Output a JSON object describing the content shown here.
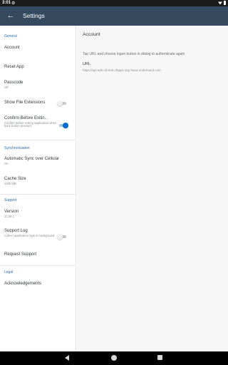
{
  "status_bar": {
    "time": "3:01",
    "system_icon": "settings-gear-icon"
  },
  "app_bar": {
    "back_icon": "arrow-back-icon",
    "title": "Settings"
  },
  "sections": {
    "general": {
      "header": "General",
      "account": "Account",
      "reset_app": "Reset App",
      "passcode": {
        "title": "Passcode",
        "value": "Off"
      },
      "show_file_extensions": {
        "title": "Show File Extensions",
        "enabled": false
      },
      "confirm_before_exit": {
        "title": "Confirm Before Exitin..",
        "subtitle": "Confirm before exiting application when back button pressed",
        "enabled": true
      }
    },
    "synchronization": {
      "header": "Synchronization",
      "auto_sync": {
        "title": "Automatic Sync over Cellular",
        "value": "On"
      },
      "cache_size": {
        "title": "Cache Size",
        "value": "1000 MB"
      }
    },
    "support": {
      "header": "Support",
      "version": {
        "title": "Version",
        "value": "21.09.1"
      },
      "support_log": {
        "title": "Support Log",
        "subtitle": "Collect application logs in background",
        "enabled": false
      },
      "request_support": "Request Support"
    },
    "legal": {
      "header": "Legal",
      "acknowledgements": "Acknowledgements"
    }
  },
  "detail": {
    "title": "Account",
    "instructions": "Tap URL and choose logon button in dialog to authenticate again",
    "url_label": "URL",
    "url": "https://api-sdm-di-test.cfapps.sap.hana.ondemand.com"
  },
  "colors": {
    "app_bar": "#354a5f",
    "section_header": "#2b6cb0",
    "toggle_on": "#0a6ed1"
  }
}
